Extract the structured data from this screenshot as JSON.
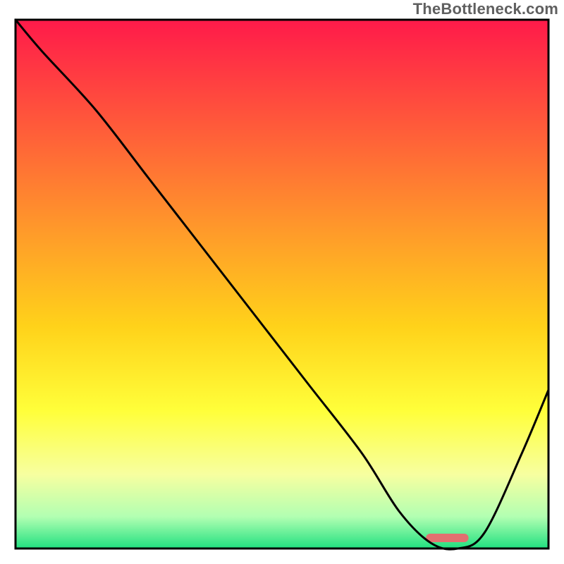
{
  "watermark": "TheBottleneck.com",
  "chart_data": {
    "type": "line",
    "title": "",
    "xlabel": "",
    "ylabel": "",
    "xlim": [
      0,
      100
    ],
    "ylim": [
      0,
      100
    ],
    "grid": false,
    "legend": false,
    "series": [
      {
        "name": "bottleneck-curve",
        "x": [
          0,
          5,
          15,
          25,
          35,
          45,
          55,
          65,
          72,
          78,
          83,
          88,
          95,
          100
        ],
        "values": [
          100,
          94,
          83,
          70,
          57,
          44,
          31,
          18,
          7,
          1,
          0,
          3,
          18,
          30
        ]
      }
    ],
    "highlight_bar": {
      "x_start": 77,
      "x_end": 85,
      "y": 2,
      "color": "#e27070"
    },
    "background": {
      "type": "vertical-gradient",
      "stops": [
        {
          "offset": 0,
          "color": "#ff1a4a"
        },
        {
          "offset": 20,
          "color": "#ff5a3a"
        },
        {
          "offset": 40,
          "color": "#ff9a2a"
        },
        {
          "offset": 58,
          "color": "#ffd21a"
        },
        {
          "offset": 74,
          "color": "#ffff3a"
        },
        {
          "offset": 86,
          "color": "#f7ffa0"
        },
        {
          "offset": 94,
          "color": "#b2ffb2"
        },
        {
          "offset": 100,
          "color": "#20e080"
        }
      ]
    },
    "frame_color": "#000000"
  }
}
